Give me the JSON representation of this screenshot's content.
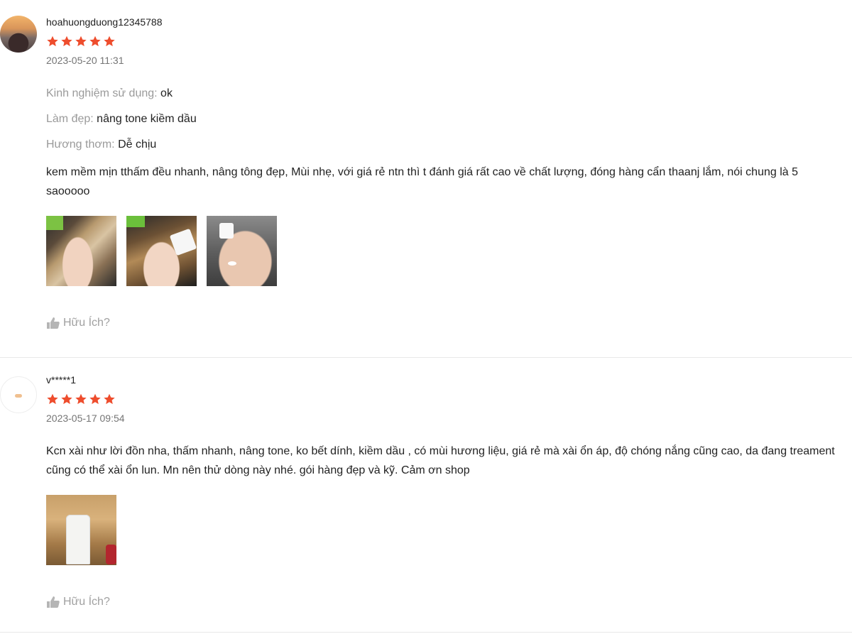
{
  "colors": {
    "star": "#ee4d2d",
    "muted": "#9a9a9a",
    "text": "#222222"
  },
  "reviews": [
    {
      "username": "hoahuongduong12345788",
      "rating": 5,
      "date": "2023-05-20 11:31",
      "avatar": "user-photo",
      "attributes": [
        {
          "key": "Kinh nghiệm sử dụng:",
          "value": "ok"
        },
        {
          "key": "Làm đẹp:",
          "value": "nâng tone kiềm dầu"
        },
        {
          "key": "Hương thơm:",
          "value": "Dễ chịu"
        }
      ],
      "comment": "kem mềm mịn tthấm đều nhanh, nâng tông đẹp, Mùi nhẹ, với giá rẻ ntn thì t đánh giá rất cao về chất lượng, đóng hàng cẩn thaanj lắm, nói chung là 5 saooooo",
      "helpful": "Hữu Ích?"
    },
    {
      "username": "v*****1",
      "rating": 5,
      "date": "2023-05-17 09:54",
      "avatar": "shop-logo",
      "comment": "Kcn xài như lời đồn nha, thấm nhanh, nâng tone, ko bết dính, kiềm dầu , có mùi hương liệu, giá rẻ mà xài ổn áp, độ chóng nắng cũng cao, da đang treament cũng có thể xài ổn lun. Mn nên thử dòng này nhé. gói hàng đẹp và kỹ. Cảm ơn shop",
      "helpful": "Hữu Ích?"
    }
  ]
}
